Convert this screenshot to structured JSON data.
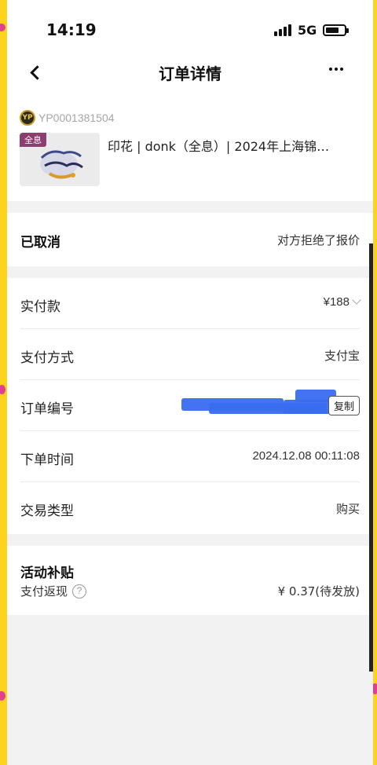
{
  "status_bar": {
    "time": "14:19",
    "network": "5G"
  },
  "nav": {
    "title": "订单详情",
    "back_icon": "chevron-left-icon",
    "more_icon": "more-horizontal-icon"
  },
  "product": {
    "shop_id": "YP0001381504",
    "tag": "全息",
    "title": "印花 | donk（全息）| 2024年上海锦…"
  },
  "order_status": {
    "label": "已取消",
    "note": "对方拒绝了报价"
  },
  "info": {
    "rows": [
      {
        "label": "实付款",
        "value": "¥188"
      },
      {
        "label": "支付方式",
        "value": "支付宝"
      },
      {
        "label": "订单编号",
        "value": ""
      },
      {
        "label": "下单时间",
        "value": "2024.12.08 00:11:08"
      },
      {
        "label": "交易类型",
        "value": "购买"
      }
    ],
    "copy_label": "复制"
  },
  "subsidy": {
    "title": "活动补贴",
    "label": "支付返现",
    "help_symbol": "?",
    "value": "¥ 0.37(待发放)"
  },
  "colors": {
    "frame": "#ffd21e",
    "redaction": "#3a6cf0",
    "tag_bg": "#8c3f6e"
  }
}
